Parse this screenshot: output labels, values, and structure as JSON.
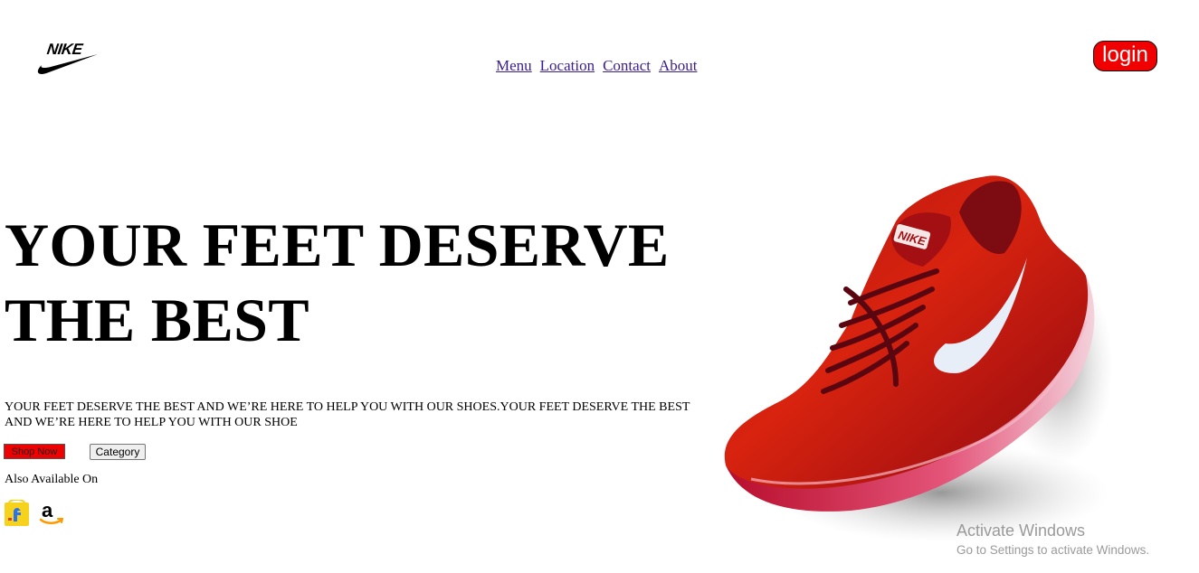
{
  "header": {
    "logo_text": "NIKE",
    "nav": {
      "items": [
        {
          "label": "Menu"
        },
        {
          "label": "Location"
        },
        {
          "label": "Contact"
        },
        {
          "label": "About"
        }
      ]
    },
    "login_label": "login"
  },
  "hero": {
    "title_line1": "YOUR FEET DESERVE",
    "title_line2": "THE BEST",
    "description": "YOUR FEET DESERVE THE BEST AND WE’RE HERE TO HELP YOU WITH OUR SHOES.YOUR FEET DESERVE THE BEST AND WE’RE HERE TO HELP YOU WITH OUR SHOE",
    "shop_now_label": "Shop Now",
    "category_label": "Category",
    "also_available_label": "Also Available On",
    "stores": [
      {
        "icon": "flipkart-icon"
      },
      {
        "icon": "amazon-icon"
      }
    ]
  },
  "shoe_image": {
    "icon": "red-running-shoe-image"
  },
  "watermark": {
    "line1": "Activate Windows",
    "line2": "Go to Settings to activate Windows."
  },
  "colors": {
    "accent_red": "#f00000",
    "link": "#3b1e8a",
    "watermark": "#9a9a9a"
  }
}
